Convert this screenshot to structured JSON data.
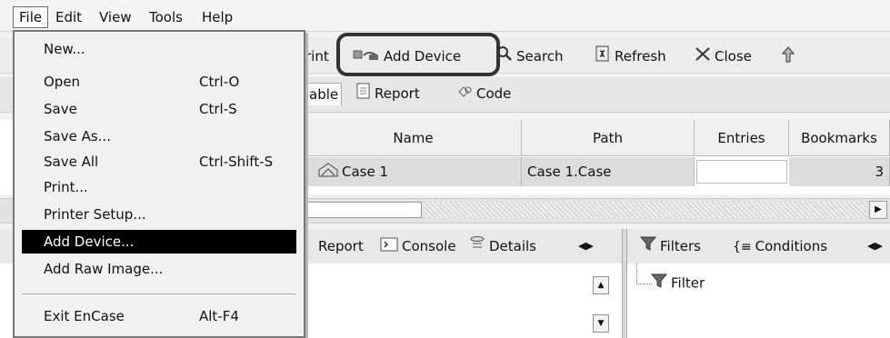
{
  "menubar": {
    "items": [
      "File",
      "Edit",
      "View",
      "Tools",
      "Help"
    ]
  },
  "toolbar": {
    "print_partial": "rint",
    "add_device": "Add Device",
    "search": "Search",
    "refresh": "Refresh",
    "close": "Close"
  },
  "tabs": {
    "table_partial": "able",
    "report": "Report",
    "code": "Code"
  },
  "grid": {
    "columns": [
      "Name",
      "Path",
      "Entries",
      "Bookmarks"
    ],
    "row": {
      "name": "Case 1",
      "path": "Case 1.Case",
      "entries": "",
      "bookmarks": "3"
    }
  },
  "lower_left_tabs": [
    "Report",
    "Console",
    "Details"
  ],
  "lower_right_tabs": [
    "Filters",
    "Conditions"
  ],
  "filter_tree": {
    "root": "Filter"
  },
  "file_menu": {
    "items": [
      {
        "label": "New...",
        "shortcut": ""
      },
      {
        "label": "Open",
        "shortcut": "Ctrl-O"
      },
      {
        "label": "Save",
        "shortcut": "Ctrl-S"
      },
      {
        "label": "Save As...",
        "shortcut": ""
      },
      {
        "label": "Save All",
        "shortcut": "Ctrl-Shift-S"
      },
      {
        "label": "Print...",
        "shortcut": ""
      },
      {
        "label": "Printer Setup...",
        "shortcut": ""
      },
      {
        "label": "Add Device...",
        "shortcut": ""
      },
      {
        "label": "Add Raw Image...",
        "shortcut": ""
      },
      {
        "label": "Exit EnCase",
        "shortcut": "Alt-F4"
      }
    ],
    "selected": "Add Device..."
  },
  "icons": [
    "add-device-icon",
    "search-icon",
    "refresh-icon",
    "close-icon",
    "up-icon",
    "report-icon",
    "code-icon",
    "case-icon",
    "console-icon",
    "details-icon",
    "filter-icon",
    "conditions-icon"
  ],
  "colors": {
    "menu_highlight": "#000000",
    "callout_border": "#333333"
  }
}
